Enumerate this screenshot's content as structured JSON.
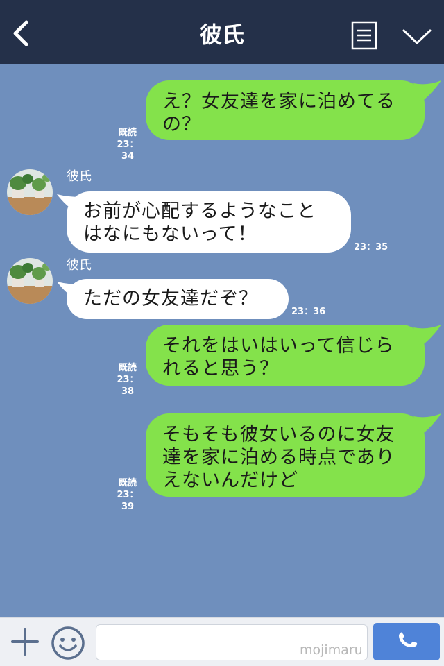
{
  "header": {
    "title": "彼氏",
    "back_icon": "chevron-left-icon",
    "menu_icon": "list-icon",
    "collapse_icon": "chevron-down-icon",
    "background": "#243049"
  },
  "chat": {
    "background": "#6f8fbd",
    "messages": [
      {
        "side": "me",
        "line1": "え？女友達を家に泊めてる",
        "line2": "の？",
        "read": "既読",
        "time": "23：34"
      },
      {
        "side": "them",
        "sender": "彼氏",
        "line1": "お前が心配するようなこと",
        "line2": "はなにもないって！",
        "time": "23：35"
      },
      {
        "side": "them",
        "sender": "彼氏",
        "line1": "ただの女友達だぞ？",
        "time": "23：36"
      },
      {
        "side": "me",
        "line1": "それをはいはいって信じら",
        "line2": "れると思う？",
        "read": "既読",
        "time": "23：38"
      },
      {
        "side": "me",
        "line1": "そもそも彼女いるのに女友",
        "line2": "達を家に泊める時点であり",
        "line3": "えないんだけど",
        "read": "既読",
        "time": "23：39"
      }
    ],
    "my_bubble_color": "#84e24b",
    "their_bubble_color": "#ffffff"
  },
  "inputbar": {
    "plus_icon": "plus-icon",
    "emoji_icon": "smiley-icon",
    "send_icon": "phone-icon",
    "watermark": "mojimaru",
    "placeholder": ""
  }
}
